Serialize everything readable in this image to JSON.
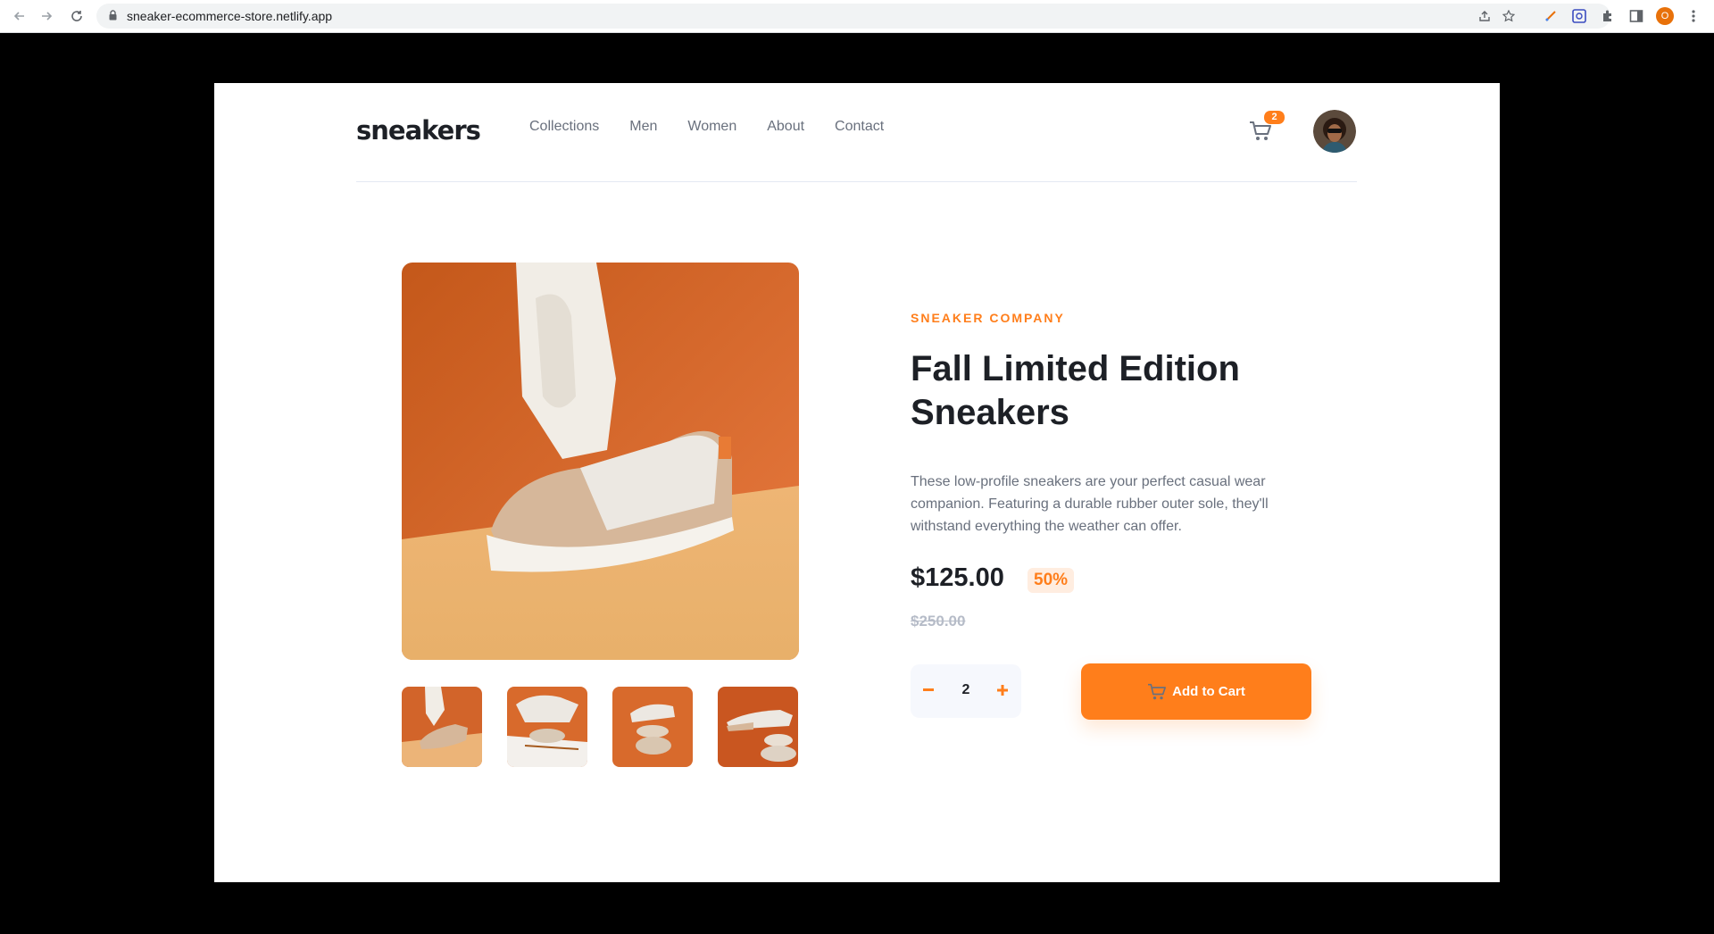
{
  "browser": {
    "url": "sneaker-ecommerce-store.netlify.app",
    "profile_initial": "O"
  },
  "header": {
    "logo": "sneakers",
    "nav": [
      "Collections",
      "Men",
      "Women",
      "About",
      "Contact"
    ],
    "cart_count": "2"
  },
  "product": {
    "company": "SNEAKER COMPANY",
    "title": "Fall Limited Edition Sneakers",
    "description": "These low-profile sneakers are your perfect casual wear companion. Featuring a durable rubber outer sole, they'll withstand everything the weather can offer.",
    "price": "$125.00",
    "discount": "50%",
    "original_price": "$250.00",
    "quantity": "2",
    "add_to_cart": "Add to Cart"
  },
  "colors": {
    "accent": "#ff7e1b",
    "accent_pale": "#ffede0",
    "dark": "#1d2026",
    "gray": "#69707d"
  },
  "icons": [
    "back-arrow-icon",
    "forward-arrow-icon",
    "reload-icon",
    "lock-icon",
    "share-icon",
    "star-icon",
    "extension-icon",
    "puzzle-icon",
    "sidebar-icon",
    "menu-dots-icon",
    "cart-icon",
    "minus-icon",
    "plus-icon"
  ]
}
